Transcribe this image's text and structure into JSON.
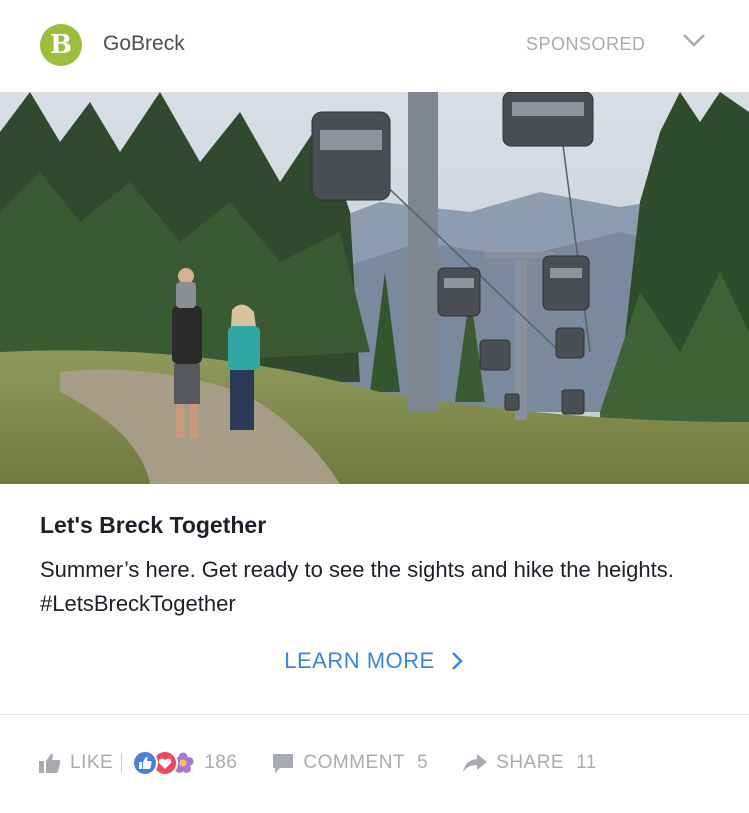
{
  "header": {
    "logo_letter": "B",
    "page_name": "GoBreck",
    "sponsored_label": "SPONSORED"
  },
  "ad": {
    "headline": "Let's Breck Together",
    "description": "Summer’s here. Get ready to see the sights and hike the heights. #LetsBreckTogether",
    "cta_label": "LEARN MORE"
  },
  "actions": {
    "like_label": "LIKE",
    "reactions_count": "186",
    "comment_label": "COMMENT",
    "comment_count": "5",
    "share_label": "SHARE",
    "share_count": "11"
  },
  "colors": {
    "logo_green": "#9bbf3b",
    "cta_blue": "#3b86e0",
    "muted_gray": "#a8acb2"
  },
  "icons": [
    "chevron-down-icon",
    "chevron-right-icon",
    "thumbs-up-icon",
    "like-reaction-icon",
    "love-reaction-icon",
    "flower-reaction-icon",
    "comment-icon",
    "share-arrow-icon"
  ]
}
